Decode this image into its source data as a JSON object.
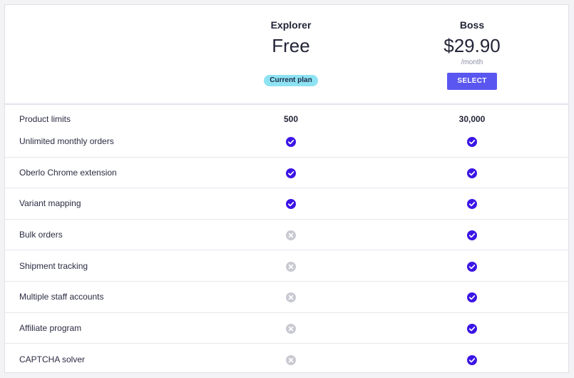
{
  "colors": {
    "accent": "#5a56f0",
    "check": "#3b15e6",
    "cross": "#c9c9d2",
    "badge": "#8ee3f2"
  },
  "plans": [
    {
      "name": "Explorer",
      "price": "Free",
      "badge": "Current plan"
    },
    {
      "name": "Boss",
      "price": "$29.90",
      "period": "/month",
      "button": "SELECT"
    }
  ],
  "limits_row": {
    "label": "Product limits",
    "values": [
      "500",
      "30,000"
    ]
  },
  "features": [
    {
      "label": "Unlimited monthly orders",
      "explorer": "check-icon",
      "boss": "check-icon"
    },
    {
      "label": "Oberlo Chrome extension",
      "explorer": "check-icon",
      "boss": "check-icon"
    },
    {
      "label": "Variant mapping",
      "explorer": "check-icon",
      "boss": "check-icon"
    },
    {
      "label": "Bulk orders",
      "explorer": "cross-icon",
      "boss": "check-icon"
    },
    {
      "label": "Shipment tracking",
      "explorer": "cross-icon",
      "boss": "check-icon"
    },
    {
      "label": "Multiple staff accounts",
      "explorer": "cross-icon",
      "boss": "check-icon"
    },
    {
      "label": "Affiliate program",
      "explorer": "cross-icon",
      "boss": "check-icon"
    },
    {
      "label": "CAPTCHA solver",
      "explorer": "cross-icon",
      "boss": "check-icon"
    }
  ]
}
